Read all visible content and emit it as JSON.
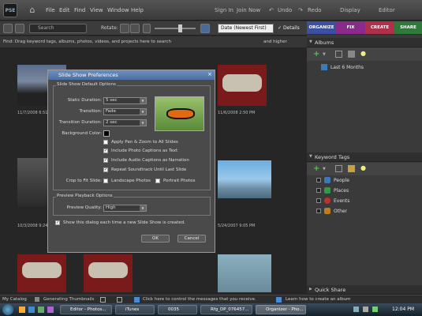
{
  "app": {
    "logo_text": "PSE"
  },
  "menu": {
    "items": [
      "File",
      "Edit",
      "Find",
      "View",
      "Window",
      "Help"
    ],
    "sign_in": "Sign In",
    "join_now": "Join Now",
    "undo": "Undo",
    "redo": "Redo",
    "display": "Display",
    "editor": "Editor"
  },
  "toolbar": {
    "search_placeholder": "Search",
    "rotate_label": "Rotate:",
    "sort": "Date (Newest First)",
    "details_label": "Details"
  },
  "tabs": [
    {
      "label": "ORGANIZE",
      "color": "#3c4fa0"
    },
    {
      "label": "FIX",
      "color": "#8a2a8a"
    },
    {
      "label": "CREATE",
      "color": "#b0304a"
    },
    {
      "label": "SHARE",
      "color": "#2f7a3a"
    }
  ],
  "findbar": {
    "text": "Find: Drag keyword tags, albums, photos, videos, and projects here to search",
    "and_higher": "and higher"
  },
  "grid": {
    "dates": [
      "11/7/2008 6:51 PM",
      "11/6/2008 2:50 PM",
      "10/3/2008 9:24 PM",
      "5/24/2007 9:05 PM"
    ]
  },
  "dialog": {
    "title": "Slide Show Preferences",
    "defaults_group": "Slide Show Default Options",
    "static_duration_label": "Static Duration:",
    "static_duration": "5 sec",
    "transition_label": "Transition:",
    "transition": "Fade",
    "transition_duration_label": "Transition Duration:",
    "transition_duration": "2 sec",
    "bg_color_label": "Background Color:",
    "opt_pan_zoom": "Apply Pan & Zoom to All Slides",
    "opt_captions_text": "Include Photo Captions as Text",
    "opt_audio_captions": "Include Audio Captions as Narration",
    "opt_repeat": "Repeat Soundtrack Until Last Slide",
    "crop_label": "Crop to Fit Slide:",
    "crop_landscape": "Landscape Photos",
    "crop_portrait": "Portrait Photos",
    "preview_group": "Preview Playback Options",
    "preview_quality_label": "Preview Quality:",
    "preview_quality": "High",
    "show_dialog": "Show this dialog each time a new Slide Show is created.",
    "ok": "OK",
    "cancel": "Cancel"
  },
  "albums": {
    "title": "Albums",
    "items": [
      "Last 6 Months"
    ]
  },
  "keywords": {
    "title": "Keyword Tags",
    "items": [
      {
        "label": "People",
        "color": "#3a7ab8"
      },
      {
        "label": "Places",
        "color": "#2f9a4a"
      },
      {
        "label": "Events",
        "color": "#c03030"
      },
      {
        "label": "Other",
        "color": "#c07a20"
      }
    ]
  },
  "quick_share": {
    "title": "Quick Share"
  },
  "status": {
    "catalog": "My Catalog",
    "progress": "Generating Thumbnails",
    "message": "Click here to control the messages that you receive.",
    "learn": "Learn how to create an album"
  },
  "taskbar": {
    "tasks": [
      "Editor - Photos...",
      "iTunes",
      "0035",
      "Rfg_DP_076457...",
      "Organizer - Pho..."
    ],
    "time": "12:04 PM"
  }
}
